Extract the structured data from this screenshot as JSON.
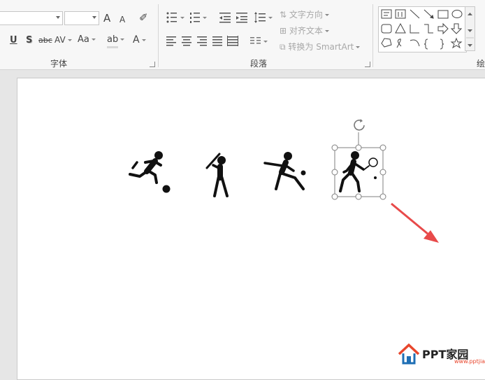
{
  "ribbon": {
    "font_group_label": "字体",
    "paragraph_group_label": "段落",
    "drawing_group_label": "绘",
    "font": {
      "grow_font": "A",
      "shrink_font": "A",
      "underline": "U",
      "shadow": "S",
      "strikethrough": "abc",
      "char_spacing": "AV",
      "change_case": "Aa",
      "font_color": "A"
    },
    "paragraph": {
      "text_direction": "文字方向",
      "align_text": "对齐文本",
      "convert_smartart": "转换为 SmartArt"
    },
    "shapes_gallery": [
      "text-box-icon",
      "vertical-text-box-icon",
      "line-icon",
      "arrow-line-icon",
      "rectangle-icon",
      "oval-icon",
      "rounded-rectangle-icon",
      "triangle-icon",
      "elbow-connector-icon",
      "elbow-arrow-icon",
      "right-arrow-icon",
      "down-arrow-icon",
      "freeform-icon",
      "scribble-icon",
      "arc-icon",
      "left-brace-icon",
      "right-brace-icon",
      "star-icon"
    ]
  },
  "slide": {
    "icons": [
      "soccer-player-icon",
      "baseball-batter-icon",
      "cricket-bowler-icon",
      "tennis-player-icon"
    ],
    "selected_icon": "tennis-player-icon"
  },
  "annotation": {
    "arrow_color": "#e84a4a"
  },
  "watermark": {
    "brand": "PPT家园",
    "url": "www.pptjia.com"
  },
  "colors": {
    "ribbon_bg": "#f7f7f7",
    "app_bg": "#e6e6e6",
    "slide_bg": "#ffffff"
  }
}
